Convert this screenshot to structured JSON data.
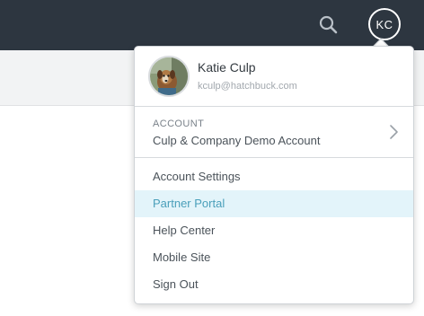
{
  "header": {
    "search_icon": "search-icon",
    "user_initials": "KC"
  },
  "profile": {
    "name": "Katie Culp",
    "email": "kculp@hatchbuck.com"
  },
  "account": {
    "label": "ACCOUNT",
    "name": "Culp & Company Demo Account",
    "chevron_icon": "chevron-right-icon"
  },
  "menu": {
    "items": [
      {
        "label": "Account Settings"
      },
      {
        "label": "Partner Portal"
      },
      {
        "label": "Help Center"
      },
      {
        "label": "Mobile Site"
      },
      {
        "label": "Sign Out"
      }
    ]
  },
  "colors": {
    "header_bg": "#2d3640",
    "highlight_bg": "#e3f4fa",
    "highlight_text": "#4a9fba"
  }
}
